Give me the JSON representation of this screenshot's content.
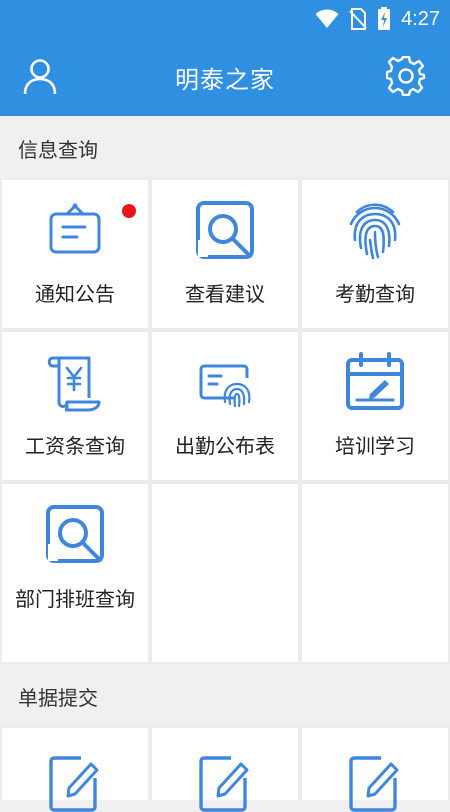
{
  "status_bar": {
    "time": "4:27",
    "icons": [
      "wifi-icon",
      "no-sim-icon",
      "battery-charging-icon"
    ]
  },
  "app_bar": {
    "title": "明泰之家",
    "left_icon": "user-icon",
    "right_icon": "settings-icon"
  },
  "colors": {
    "primary": "#2f8fe0",
    "icon_blue": "#3f86dc",
    "badge_red": "#e8161b"
  },
  "sections": [
    {
      "title": "信息查询",
      "items": [
        {
          "label": "通知公告",
          "icon": "notice-board-icon",
          "badge": true
        },
        {
          "label": "查看建议",
          "icon": "search-suggestion-icon",
          "badge": false
        },
        {
          "label": "考勤查询",
          "icon": "fingerprint-icon",
          "badge": false
        },
        {
          "label": "工资条查询",
          "icon": "salary-scroll-icon",
          "badge": false
        },
        {
          "label": "出勤公布表",
          "icon": "attendance-card-icon",
          "badge": false
        },
        {
          "label": "培训学习",
          "icon": "calendar-edit-icon",
          "badge": false
        },
        {
          "label": "部门排班查询",
          "icon": "schedule-search-icon",
          "badge": false
        }
      ]
    },
    {
      "title": "单据提交",
      "items": [
        {
          "label": "",
          "icon": "edit-document-icon"
        },
        {
          "label": "",
          "icon": "edit-document-icon"
        },
        {
          "label": "",
          "icon": "edit-document-icon"
        }
      ]
    }
  ]
}
